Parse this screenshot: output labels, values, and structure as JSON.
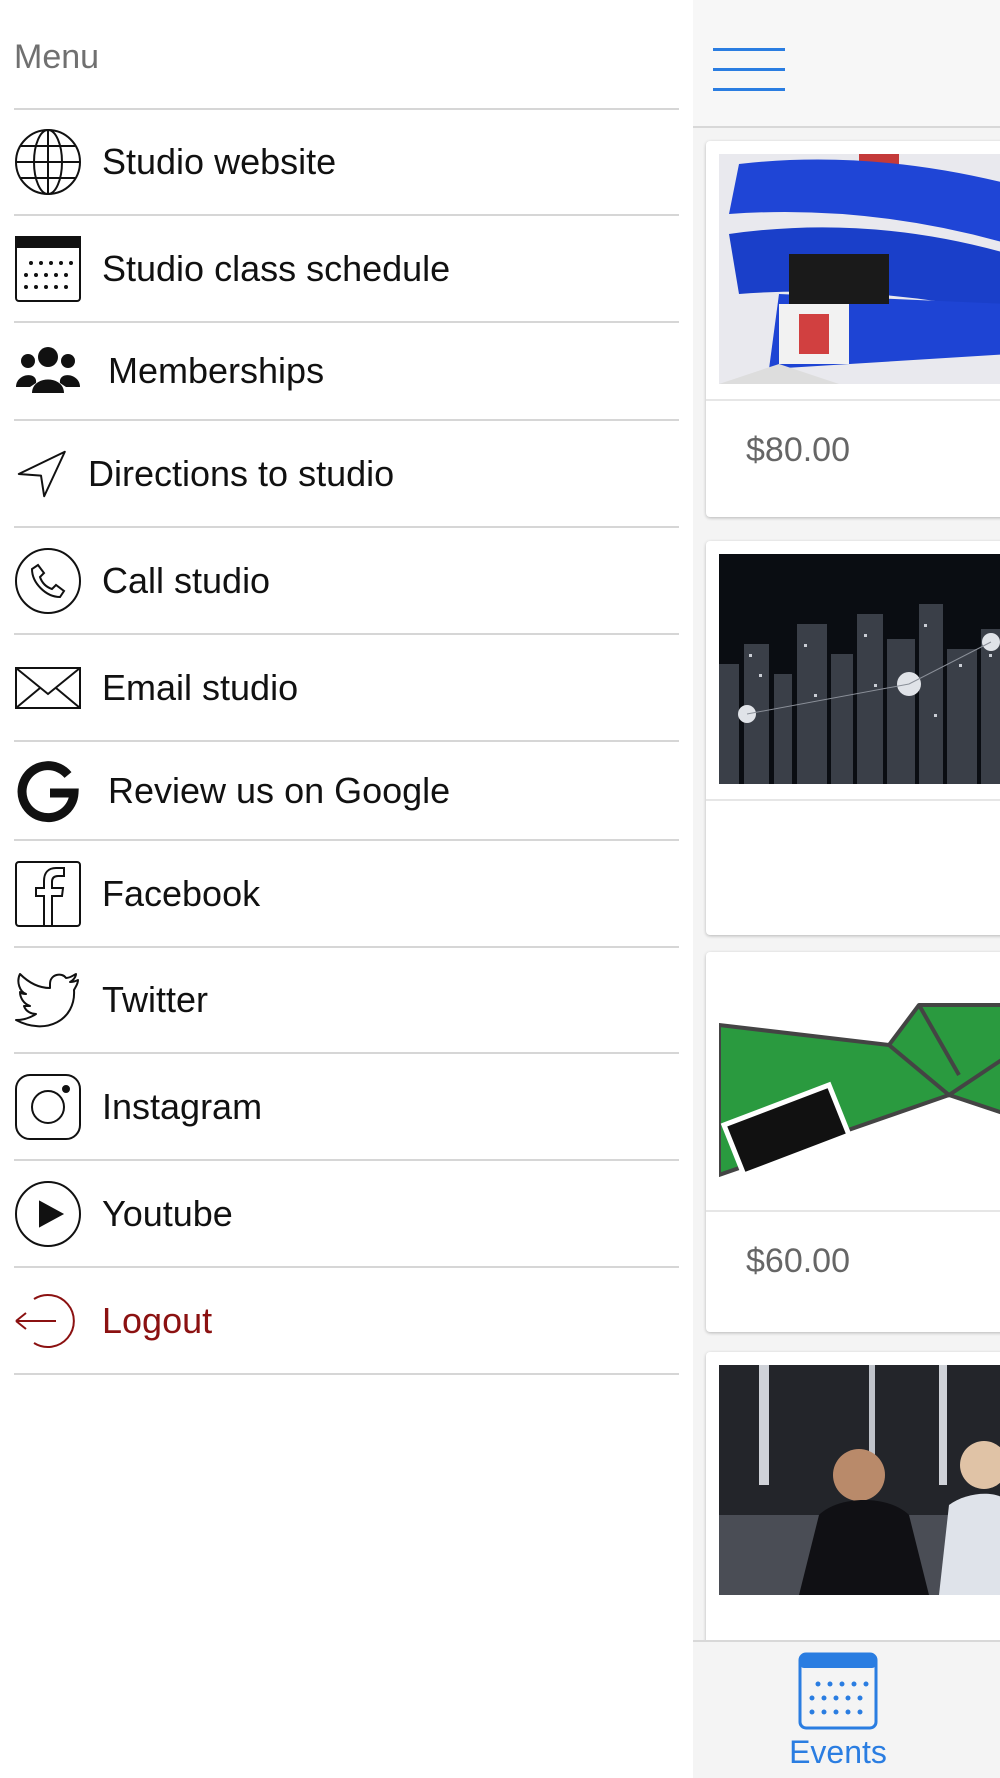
{
  "menu": {
    "title": "Menu",
    "items": [
      {
        "label": "Studio website",
        "icon": "globe-icon"
      },
      {
        "label": "Studio class schedule",
        "icon": "calendar-icon"
      },
      {
        "label": "Memberships",
        "icon": "users-icon"
      },
      {
        "label": "Directions to studio",
        "icon": "navigation-arrow-icon"
      },
      {
        "label": "Call studio",
        "icon": "phone-icon"
      },
      {
        "label": "Email studio",
        "icon": "envelope-icon"
      },
      {
        "label": "Review us on Google",
        "icon": "google-icon"
      },
      {
        "label": "Facebook",
        "icon": "facebook-icon"
      },
      {
        "label": "Twitter",
        "icon": "twitter-icon"
      },
      {
        "label": "Instagram",
        "icon": "instagram-icon"
      },
      {
        "label": "Youtube",
        "icon": "youtube-play-icon"
      },
      {
        "label": "Logout",
        "icon": "logout-icon"
      }
    ]
  },
  "main": {
    "cards": [
      {
        "price": "$80.00",
        "image": "blue-belt-photo"
      },
      {
        "price": "",
        "image": "city-night-photo"
      },
      {
        "price": "$60.00",
        "image": "green-belt-illustration"
      },
      {
        "price": "",
        "image": "martial-arts-class-photo"
      }
    ]
  },
  "tabbar": {
    "events_label": "Events"
  },
  "colors": {
    "accent": "#2a7de1",
    "logout": "#8b1111",
    "divider": "#d6d6d6"
  }
}
